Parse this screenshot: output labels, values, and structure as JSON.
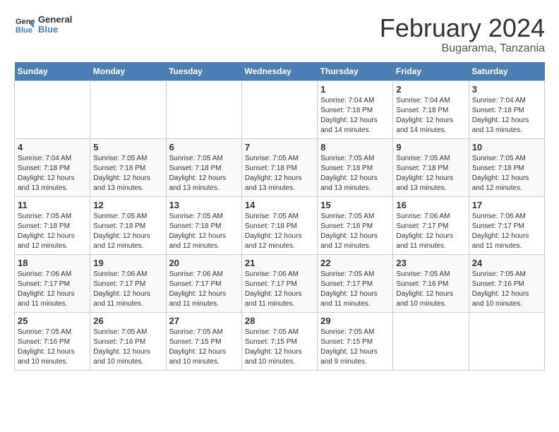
{
  "header": {
    "logo_general": "General",
    "logo_blue": "Blue",
    "title": "February 2024",
    "subtitle": "Bugarama, Tanzania"
  },
  "calendar": {
    "weekdays": [
      "Sunday",
      "Monday",
      "Tuesday",
      "Wednesday",
      "Thursday",
      "Friday",
      "Saturday"
    ],
    "weeks": [
      [
        {
          "day": "",
          "info": ""
        },
        {
          "day": "",
          "info": ""
        },
        {
          "day": "",
          "info": ""
        },
        {
          "day": "",
          "info": ""
        },
        {
          "day": "1",
          "info": "Sunrise: 7:04 AM\nSunset: 7:18 PM\nDaylight: 12 hours\nand 14 minutes."
        },
        {
          "day": "2",
          "info": "Sunrise: 7:04 AM\nSunset: 7:18 PM\nDaylight: 12 hours\nand 14 minutes."
        },
        {
          "day": "3",
          "info": "Sunrise: 7:04 AM\nSunset: 7:18 PM\nDaylight: 12 hours\nand 13 minutes."
        }
      ],
      [
        {
          "day": "4",
          "info": "Sunrise: 7:04 AM\nSunset: 7:18 PM\nDaylight: 12 hours\nand 13 minutes."
        },
        {
          "day": "5",
          "info": "Sunrise: 7:05 AM\nSunset: 7:18 PM\nDaylight: 12 hours\nand 13 minutes."
        },
        {
          "day": "6",
          "info": "Sunrise: 7:05 AM\nSunset: 7:18 PM\nDaylight: 12 hours\nand 13 minutes."
        },
        {
          "day": "7",
          "info": "Sunrise: 7:05 AM\nSunset: 7:18 PM\nDaylight: 12 hours\nand 13 minutes."
        },
        {
          "day": "8",
          "info": "Sunrise: 7:05 AM\nSunset: 7:18 PM\nDaylight: 12 hours\nand 13 minutes."
        },
        {
          "day": "9",
          "info": "Sunrise: 7:05 AM\nSunset: 7:18 PM\nDaylight: 12 hours\nand 13 minutes."
        },
        {
          "day": "10",
          "info": "Sunrise: 7:05 AM\nSunset: 7:18 PM\nDaylight: 12 hours\nand 12 minutes."
        }
      ],
      [
        {
          "day": "11",
          "info": "Sunrise: 7:05 AM\nSunset: 7:18 PM\nDaylight: 12 hours\nand 12 minutes."
        },
        {
          "day": "12",
          "info": "Sunrise: 7:05 AM\nSunset: 7:18 PM\nDaylight: 12 hours\nand 12 minutes."
        },
        {
          "day": "13",
          "info": "Sunrise: 7:05 AM\nSunset: 7:18 PM\nDaylight: 12 hours\nand 12 minutes."
        },
        {
          "day": "14",
          "info": "Sunrise: 7:05 AM\nSunset: 7:18 PM\nDaylight: 12 hours\nand 12 minutes."
        },
        {
          "day": "15",
          "info": "Sunrise: 7:05 AM\nSunset: 7:18 PM\nDaylight: 12 hours\nand 12 minutes."
        },
        {
          "day": "16",
          "info": "Sunrise: 7:06 AM\nSunset: 7:17 PM\nDaylight: 12 hours\nand 11 minutes."
        },
        {
          "day": "17",
          "info": "Sunrise: 7:06 AM\nSunset: 7:17 PM\nDaylight: 12 hours\nand 11 minutes."
        }
      ],
      [
        {
          "day": "18",
          "info": "Sunrise: 7:06 AM\nSunset: 7:17 PM\nDaylight: 12 hours\nand 11 minutes."
        },
        {
          "day": "19",
          "info": "Sunrise: 7:06 AM\nSunset: 7:17 PM\nDaylight: 12 hours\nand 11 minutes."
        },
        {
          "day": "20",
          "info": "Sunrise: 7:06 AM\nSunset: 7:17 PM\nDaylight: 12 hours\nand 11 minutes."
        },
        {
          "day": "21",
          "info": "Sunrise: 7:06 AM\nSunset: 7:17 PM\nDaylight: 12 hours\nand 11 minutes."
        },
        {
          "day": "22",
          "info": "Sunrise: 7:05 AM\nSunset: 7:17 PM\nDaylight: 12 hours\nand 11 minutes."
        },
        {
          "day": "23",
          "info": "Sunrise: 7:05 AM\nSunset: 7:16 PM\nDaylight: 12 hours\nand 10 minutes."
        },
        {
          "day": "24",
          "info": "Sunrise: 7:05 AM\nSunset: 7:16 PM\nDaylight: 12 hours\nand 10 minutes."
        }
      ],
      [
        {
          "day": "25",
          "info": "Sunrise: 7:05 AM\nSunset: 7:16 PM\nDaylight: 12 hours\nand 10 minutes."
        },
        {
          "day": "26",
          "info": "Sunrise: 7:05 AM\nSunset: 7:16 PM\nDaylight: 12 hours\nand 10 minutes."
        },
        {
          "day": "27",
          "info": "Sunrise: 7:05 AM\nSunset: 7:15 PM\nDaylight: 12 hours\nand 10 minutes."
        },
        {
          "day": "28",
          "info": "Sunrise: 7:05 AM\nSunset: 7:15 PM\nDaylight: 12 hours\nand 10 minutes."
        },
        {
          "day": "29",
          "info": "Sunrise: 7:05 AM\nSunset: 7:15 PM\nDaylight: 12 hours\nand 9 minutes."
        },
        {
          "day": "",
          "info": ""
        },
        {
          "day": "",
          "info": ""
        }
      ]
    ]
  }
}
